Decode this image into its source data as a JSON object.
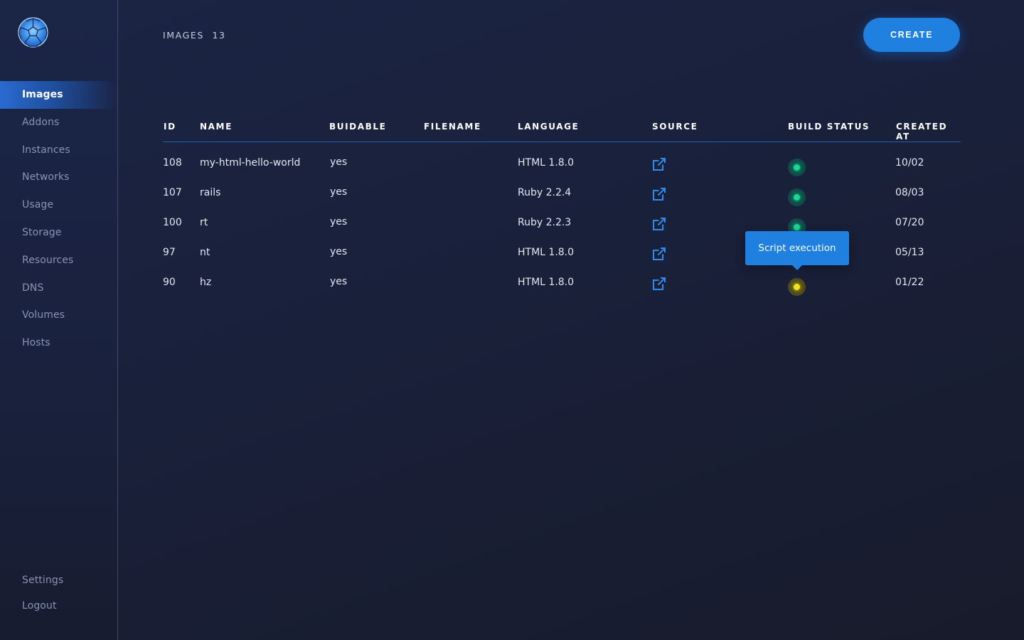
{
  "sidebar": {
    "items": [
      {
        "label": "Images",
        "active": true
      },
      {
        "label": "Addons"
      },
      {
        "label": "Instances"
      },
      {
        "label": "Networks"
      },
      {
        "label": "Usage"
      },
      {
        "label": "Storage"
      },
      {
        "label": "Resources"
      },
      {
        "label": "DNS"
      },
      {
        "label": "Volumes"
      },
      {
        "label": "Hosts"
      }
    ],
    "bottom": [
      {
        "label": "Settings"
      },
      {
        "label": "Logout"
      }
    ]
  },
  "header": {
    "title": "IMAGES",
    "count": "13",
    "create_label": "CREATE"
  },
  "table": {
    "columns": [
      "ID",
      "NAME",
      "BUIDABLE",
      "FILENAME",
      "LANGUAGE",
      "SOURCE",
      "BUILD STATUS",
      "CREATED AT"
    ],
    "rows": [
      {
        "id": "108",
        "name": "my-html-hello-world",
        "buildable": "yes",
        "filename": "",
        "language": "HTML 1.8.0",
        "source_icon": "external-link-icon",
        "status": "success",
        "created": "10/02"
      },
      {
        "id": "107",
        "name": "rails",
        "buildable": "yes",
        "filename": "",
        "language": "Ruby 2.2.4",
        "source_icon": "external-link-icon",
        "status": "success",
        "created": "08/03"
      },
      {
        "id": "100",
        "name": "rt",
        "buildable": "yes",
        "filename": "",
        "language": "Ruby 2.2.3",
        "source_icon": "external-link-icon",
        "status": "success",
        "created": "07/20"
      },
      {
        "id": "97",
        "name": "nt",
        "buildable": "yes",
        "filename": "",
        "language": "HTML 1.8.0",
        "source_icon": "external-link-icon",
        "status": "success",
        "created": "05/13"
      },
      {
        "id": "90",
        "name": "hz",
        "buildable": "yes",
        "filename": "",
        "language": "HTML 1.8.0",
        "source_icon": "external-link-icon",
        "status": "pending",
        "created": "01/22"
      }
    ]
  },
  "tooltip": {
    "text": "Script execution"
  },
  "colors": {
    "accent": "#1f80e0",
    "status_success": "#17d98e",
    "status_pending": "#f3e418"
  }
}
